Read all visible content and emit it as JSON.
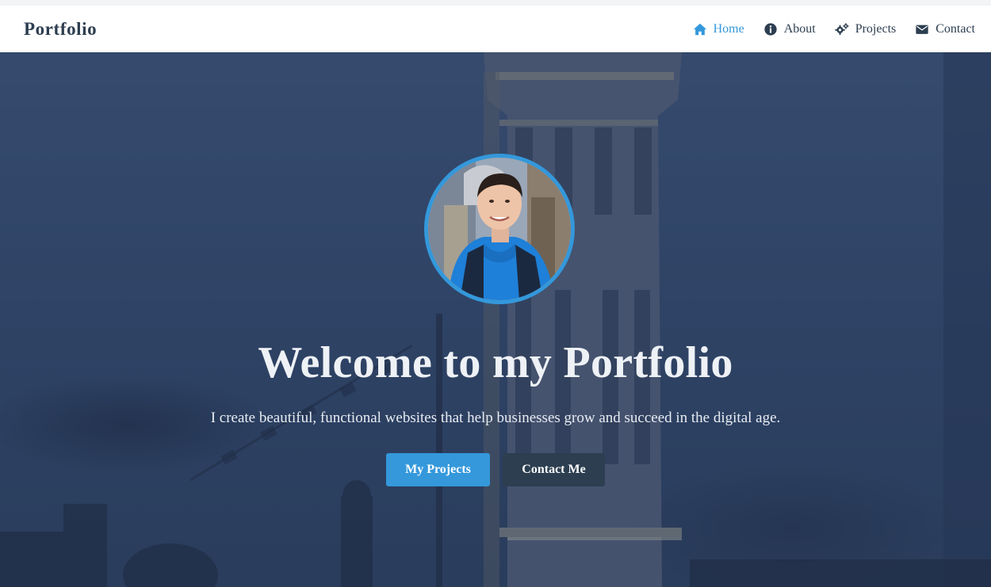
{
  "brand": "Portfolio",
  "nav": [
    {
      "label": "Home",
      "icon": "home-icon",
      "active": true
    },
    {
      "label": "About",
      "icon": "info-circle-icon",
      "active": false
    },
    {
      "label": "Projects",
      "icon": "cogs-icon",
      "active": false
    },
    {
      "label": "Contact",
      "icon": "envelope-icon",
      "active": false
    }
  ],
  "hero": {
    "title": "Welcome to my Portfolio",
    "subtitle": "I create beautiful, functional websites that help businesses grow and succeed in the digital age.",
    "primary_button": "My Projects",
    "secondary_button": "Contact Me"
  },
  "colors": {
    "accent": "#3498db",
    "dark": "#2c3e50",
    "white": "#ffffff"
  }
}
